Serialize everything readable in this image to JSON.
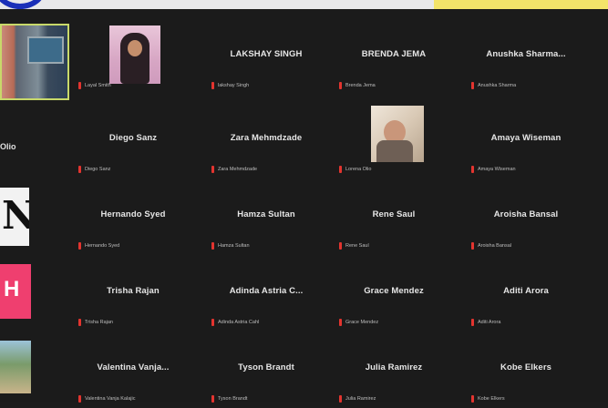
{
  "left_column": {
    "row2_name_fragment": "Olio",
    "row3_letter": "N",
    "row4_letter": "H"
  },
  "tiles": [
    {
      "name": "",
      "label": "Layal Smith"
    },
    {
      "name": "LAKSHAY SINGH",
      "label": "lakshay Singh"
    },
    {
      "name": "BRENDA JEMA",
      "label": "Brenda Jema"
    },
    {
      "name": "Anushka Sharma...",
      "label": "Anushka Sharma"
    },
    {
      "name": "Diego Sanz",
      "label": "Diego Sanz"
    },
    {
      "name": "Zara Mehmdzade",
      "label": "Zara Mehmdzade"
    },
    {
      "name": "",
      "label": "Lorena Olio"
    },
    {
      "name": "Amaya Wiseman",
      "label": "Amaya Wiseman"
    },
    {
      "name": "Hernando Syed",
      "label": "Hernando Syed"
    },
    {
      "name": "Hamza Sultan",
      "label": "Hamza Sultan"
    },
    {
      "name": "Rene Saul",
      "label": "Rene Saul"
    },
    {
      "name": "Aroisha Bansal",
      "label": "Aroisha Bansal"
    },
    {
      "name": "Trisha Rajan",
      "label": "Trisha Rajan"
    },
    {
      "name": "Adinda Astria C...",
      "label": "Adinda Astria Cahl"
    },
    {
      "name": "Grace Mendez",
      "label": "Grace Mendez"
    },
    {
      "name": "Aditi Arora",
      "label": "Aditi Arora"
    },
    {
      "name": "Valentina Vanja...",
      "label": "Valentina Vanja Kalajic"
    },
    {
      "name": "Tyson Brandt",
      "label": "Tyson Brandt"
    },
    {
      "name": "Julia Ramirez",
      "label": "Julia Ramirez"
    },
    {
      "name": "Kobe Elkers",
      "label": "Kobe Elkers"
    }
  ],
  "colors": {
    "background": "#1b1b1b",
    "active_speaker_border": "#c8d96a",
    "muted_mic": "#e3342f",
    "brand_blue": "#1a2fb8",
    "banner_yellow": "#f3e46a"
  }
}
